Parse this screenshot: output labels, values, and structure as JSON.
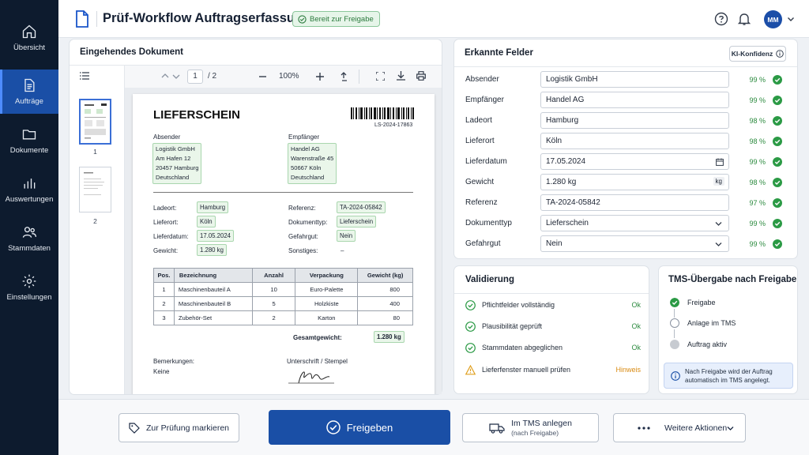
{
  "sidebar": {
    "items": [
      {
        "label": "Übersicht",
        "icon": "home-icon"
      },
      {
        "label": "Aufträge",
        "icon": "clipboard-icon",
        "active": true
      },
      {
        "label": "Dokumente",
        "icon": "folder-icon"
      },
      {
        "label": "Auswertungen",
        "icon": "bar-chart-icon"
      },
      {
        "label": "Stammdaten",
        "icon": "users-icon"
      },
      {
        "label": "Einstellungen",
        "icon": "gear-icon"
      }
    ]
  },
  "header": {
    "title": "Prüf-Workflow Auftragserfassung",
    "status_badge": "Bereit zur Freigabe",
    "avatar_initials": "MM"
  },
  "document": {
    "title": "Eingehendes Dokument",
    "page_current": "1",
    "page_total": "/ 2",
    "zoom": "100%",
    "thumbnails": [
      "1",
      "2"
    ],
    "paper": {
      "heading": "LIEFERSCHEIN",
      "barcode_number": "LS-2024-17863",
      "sender_label": "Absender",
      "sender_lines": [
        "Logistik GmbH",
        "Am Hafen 12",
        "20457 Hamburg",
        "Deutschland"
      ],
      "recipient_label": "Empfänger",
      "recipient_lines": [
        "Handel AG",
        "Warenstraße 45",
        "50667 Köln",
        "Deutschland"
      ],
      "left_fields": [
        {
          "label": "Ladeort:",
          "value": "Hamburg"
        },
        {
          "label": "Lieferort:",
          "value": "Köln"
        },
        {
          "label": "Lieferdatum:",
          "value": "17.05.2024"
        },
        {
          "label": "Gewicht:",
          "value": "1.280 kg"
        }
      ],
      "right_fields": [
        {
          "label": "Referenz:",
          "value": "TA-2024-05842"
        },
        {
          "label": "Dokumenttyp:",
          "value": "Lieferschein"
        },
        {
          "label": "Gefahrgut:",
          "value": "Nein"
        },
        {
          "label": "Sonstiges:",
          "value": "–"
        }
      ],
      "table_headers": [
        "Pos.",
        "Bezeichnung",
        "Anzahl",
        "Verpackung",
        "Gewicht (kg)"
      ],
      "table_rows": [
        [
          "1",
          "Maschinenbauteil A",
          "10",
          "Euro-Palette",
          "800"
        ],
        [
          "2",
          "Maschinenbauteil B",
          "5",
          "Holzkiste",
          "400"
        ],
        [
          "3",
          "Zubehör-Set",
          "2",
          "Karton",
          "80"
        ]
      ],
      "total_label": "Gesamtgewicht:",
      "total_value": "1.280 kg",
      "remarks_label": "Bemerkungen:",
      "remarks_value": "Keine",
      "signature_label": "Unterschrift / Stempel"
    }
  },
  "fields": {
    "title": "Erkannte Felder",
    "confidence_button": "KI-Konfidenz",
    "rows": [
      {
        "label": "Absender",
        "value": "Logistik GmbH",
        "confidence": "99 %"
      },
      {
        "label": "Empfänger",
        "value": "Handel AG",
        "confidence": "99 %"
      },
      {
        "label": "Ladeort",
        "value": "Hamburg",
        "confidence": "98 %"
      },
      {
        "label": "Lieferort",
        "value": "Köln",
        "confidence": "98 %"
      },
      {
        "label": "Lieferdatum",
        "value": "17.05.2024",
        "confidence": "99 %",
        "suffix": "calendar-icon"
      },
      {
        "label": "Gewicht",
        "value": "1.280 kg",
        "confidence": "98 %",
        "unit": "kg"
      },
      {
        "label": "Referenz",
        "value": "TA-2024-05842",
        "confidence": "97 %"
      },
      {
        "label": "Dokumenttyp",
        "value": "Lieferschein",
        "confidence": "99 %",
        "suffix": "chevron-down-icon"
      },
      {
        "label": "Gefahrgut",
        "value": "Nein",
        "confidence": "99 %",
        "suffix": "chevron-down-icon"
      }
    ]
  },
  "validation": {
    "title": "Validierung",
    "rows": [
      {
        "label": "Pflichtfelder vollständig",
        "status": "Ok",
        "type": "ok"
      },
      {
        "label": "Plausibilität geprüft",
        "status": "Ok",
        "type": "ok"
      },
      {
        "label": "Stammdaten abgeglichen",
        "status": "Ok",
        "type": "ok"
      },
      {
        "label": "Lieferfenster manuell prüfen",
        "status": "Hinweis",
        "type": "warn"
      }
    ]
  },
  "tms": {
    "title": "TMS-Übergabe nach Freigabe",
    "steps": [
      {
        "label": "Freigabe",
        "state": "done"
      },
      {
        "label": "Anlage im TMS",
        "state": "pending"
      },
      {
        "label": "Auftrag aktiv",
        "state": "inactive"
      }
    ],
    "info_line1": "Nach Freigabe wird der Auftrag",
    "info_line2": "automatisch im TMS angelegt."
  },
  "footer": {
    "mark_review": "Zur Prüfung markieren",
    "approve": "Freigeben",
    "tms_create": "Im TMS anlegen",
    "tms_create_sub": "(nach Freigabe)",
    "more_actions": "Weitere Aktionen"
  },
  "colors": {
    "sidebar_bg": "#0d1b2e",
    "accent": "#1a4fa6",
    "success": "#2b8a3e",
    "warning": "#d98b13"
  }
}
